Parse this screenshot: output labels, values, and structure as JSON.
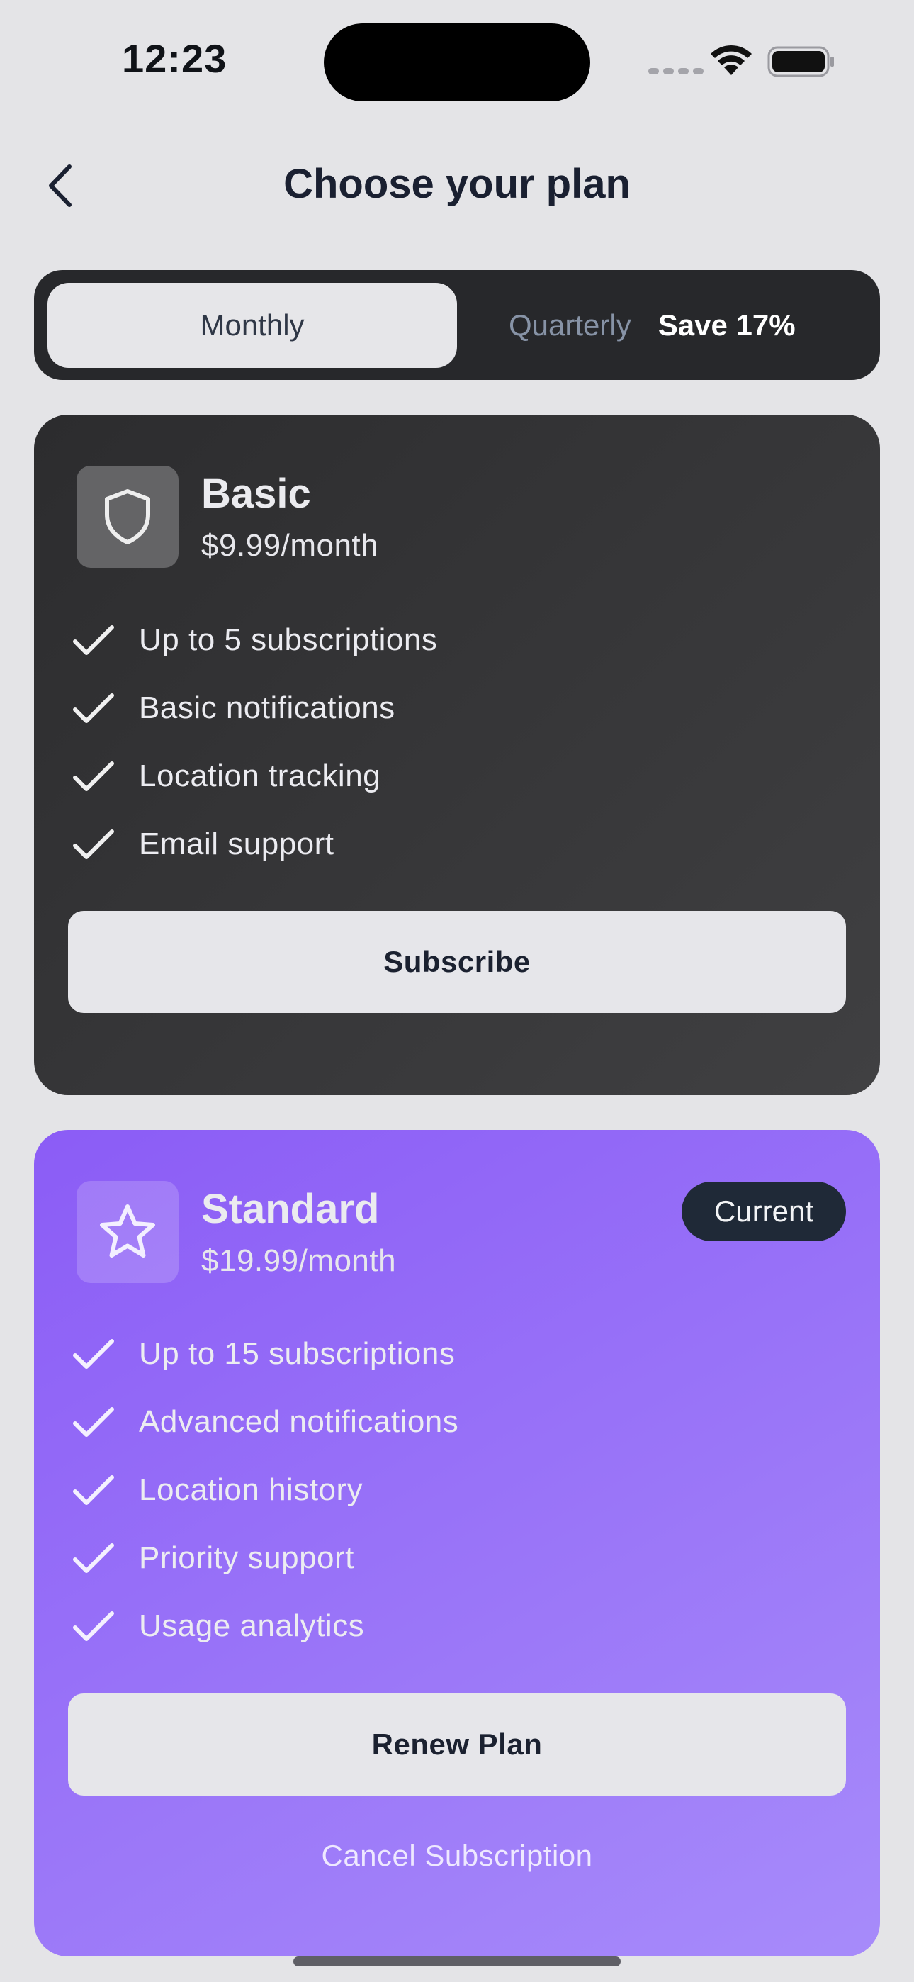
{
  "status_bar": {
    "time": "12:23"
  },
  "header": {
    "title": "Choose your plan",
    "back_icon": "chevron-left-icon"
  },
  "billing_toggle": {
    "monthly_label": "Monthly",
    "quarterly_label": "Quarterly",
    "save_label": "Save 17%",
    "selected": "Monthly"
  },
  "plans": [
    {
      "name": "Basic",
      "price": "$9.99/month",
      "icon": "shield-icon",
      "features": [
        "Up to 5 subscriptions",
        "Basic notifications",
        "Location tracking",
        "Email support"
      ],
      "button_label": "Subscribe"
    },
    {
      "name": "Standard",
      "price": "$19.99/month",
      "icon": "star-icon",
      "badge": "Current",
      "features": [
        "Up to 15 subscriptions",
        "Advanced notifications",
        "Location history",
        "Priority support",
        "Usage analytics"
      ],
      "button_label": "Renew Plan",
      "cancel_label": "Cancel Subscription"
    }
  ],
  "colors": {
    "background": "#e4e4e7",
    "basic_card": "#2c2c2e",
    "standard_card": "#8b5cf6",
    "badge": "#1f2937"
  }
}
